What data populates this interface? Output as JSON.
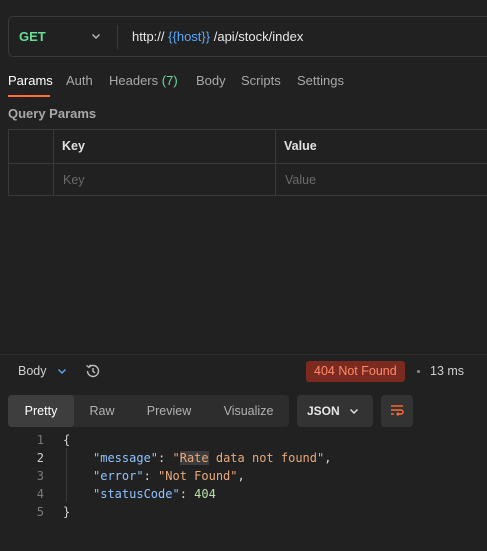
{
  "request": {
    "method": "GET",
    "url_prefix": "http://",
    "url_variable": "{{host}}",
    "url_path": "/api/stock/index"
  },
  "tabs": [
    {
      "label": "Params",
      "active": true
    },
    {
      "label": "Auth"
    },
    {
      "label": "Headers",
      "count": "(7)"
    },
    {
      "label": "Body"
    },
    {
      "label": "Scripts"
    },
    {
      "label": "Settings"
    }
  ],
  "query_params": {
    "title": "Query Params",
    "headers": [
      "Key",
      "Value"
    ],
    "placeholders": {
      "key": "Key",
      "value": "Value"
    }
  },
  "response": {
    "body_label": "Body",
    "status": "404 Not Found",
    "time": "13 ms",
    "view_tabs": [
      "Pretty",
      "Raw",
      "Preview",
      "Visualize"
    ],
    "active_view": "Pretty",
    "format": "JSON",
    "line_numbers": [
      "1",
      "2",
      "3",
      "4",
      "5"
    ],
    "json": {
      "open": "{",
      "message_key": "\"message\"",
      "message_value_part1": "\"",
      "message_value_highlight": "Rate",
      "message_value_part2": " data not found\"",
      "error_key": "\"error\"",
      "error_value": "\"Not Found\"",
      "status_key": "\"statusCode\"",
      "status_value": "404",
      "close": "}"
    }
  },
  "colors": {
    "background": "#212121",
    "method_get": "#6bdd9a",
    "variable": "#5aa8f7",
    "accent": "#ff6c37",
    "status_error_bg": "#7a2a1e",
    "status_error_text": "#ff8a6b"
  }
}
